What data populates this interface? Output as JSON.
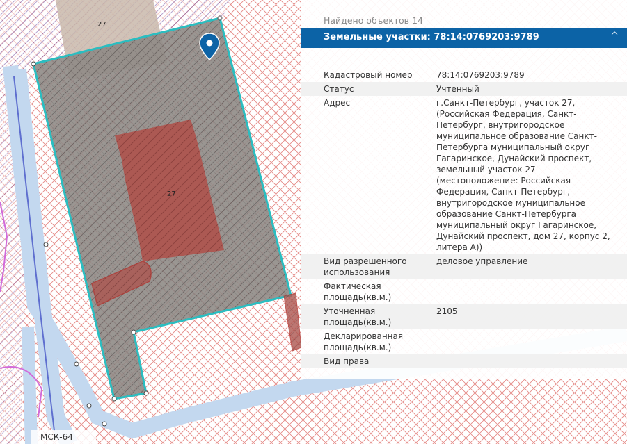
{
  "map": {
    "label_top": "27",
    "label_building": "27",
    "crs": "МСК-64"
  },
  "panel": {
    "found": "Найдено объектов 14",
    "header": "Земельные участки: 78:14:0769203:9789",
    "rows": [
      {
        "key": "Кадастровый номер",
        "value": "78:14:0769203:9789"
      },
      {
        "key": "Статус",
        "value": "Учтенный"
      },
      {
        "key": "Адрес",
        "value": "г.Санкт-Петербург, участок 27, (Российская Федерация, Санкт-Петербург, внутригородское муниципальное образование Санкт-Петербурга муниципальный округ Гагаринское, Дунайский проспект, земельный участок 27 (местоположение: Российская Федерация, Санкт-Петербург, внутригородское муниципальное образование Санкт-Петербурга муниципальный округ Гагаринское, Дунайский проспект, дом 27, корпус 2, литера А))"
      },
      {
        "key": "Вид разрешенного использования",
        "value": "деловое управление"
      },
      {
        "key": "Фактическая площадь(кв.м.)",
        "value": ""
      },
      {
        "key": "Уточненная площадь(кв.м.)",
        "value": "2105"
      },
      {
        "key": "Декларированная площадь(кв.м.)",
        "value": ""
      },
      {
        "key": "Вид права",
        "value": ""
      }
    ]
  },
  "colors": {
    "header_bg": "#0c63a6",
    "parcel_outline": "#2bbdc0",
    "hatch_red": "#d9534f",
    "hatch_purple": "#7a5aa8",
    "building": "#b0504a",
    "road_blue": "#b9d3ee"
  },
  "icons": {
    "marker": "map-pin-icon",
    "collapse": "chevron-up-icon"
  }
}
